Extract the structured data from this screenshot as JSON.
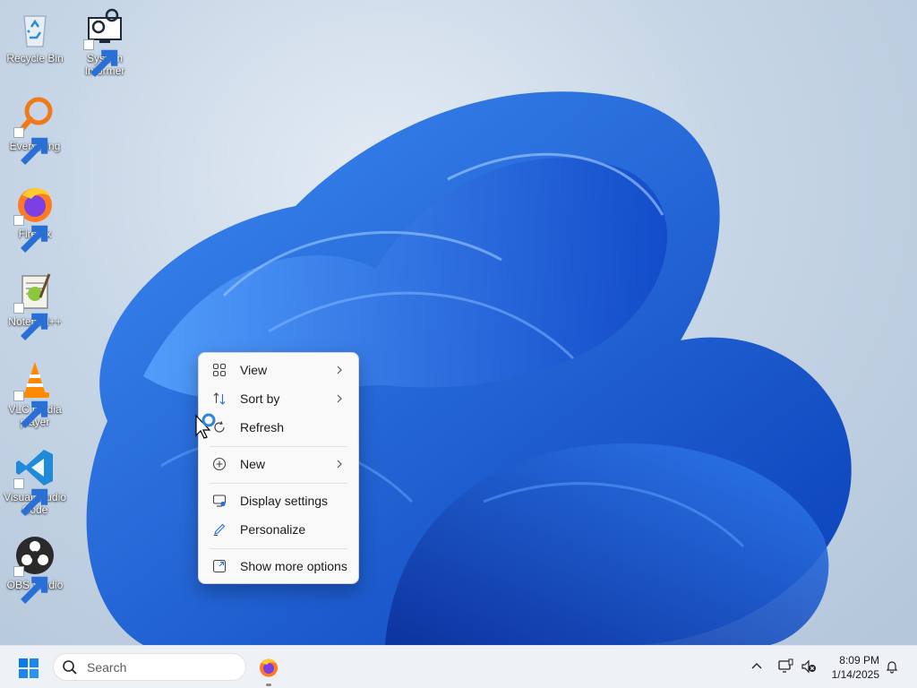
{
  "desktop": {
    "icons": [
      {
        "label": "Recycle Bin"
      },
      {
        "label": "System Informer"
      },
      {
        "label": "Everything"
      },
      {
        "label": "Firefox"
      },
      {
        "label": "Notepad++"
      },
      {
        "label": "VLC media player"
      },
      {
        "label": "Visual Studio Code"
      },
      {
        "label": "OBS Studio"
      }
    ]
  },
  "context_menu": {
    "items": [
      {
        "label": "View",
        "icon": "grid-view-icon",
        "submenu": true
      },
      {
        "label": "Sort by",
        "icon": "sort-arrows-icon",
        "submenu": true
      },
      {
        "label": "Refresh",
        "icon": "refresh-icon",
        "submenu": false
      },
      {
        "label": "New",
        "icon": "plus-circle-icon",
        "submenu": true
      },
      {
        "label": "Display settings",
        "icon": "display-settings-icon",
        "submenu": false
      },
      {
        "label": "Personalize",
        "icon": "pen-icon",
        "submenu": false
      },
      {
        "label": "Show more options",
        "icon": "share-expand-icon",
        "submenu": false
      }
    ]
  },
  "taskbar": {
    "search_placeholder": "Search",
    "clock_time": "8:09 PM",
    "clock_date": "1/14/2025"
  },
  "colors": {
    "accent": "#0067c0",
    "wallpaper_blue": "#1565e0",
    "taskbar_bg": "#eef2f7"
  }
}
